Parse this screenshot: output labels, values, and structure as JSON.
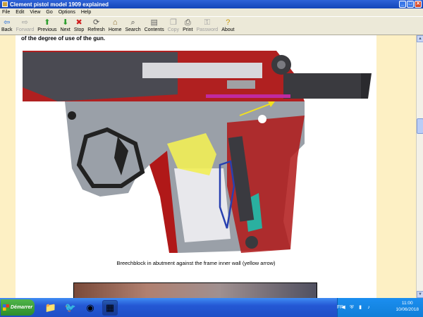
{
  "window": {
    "title": "Clement pistol model 1909 explained"
  },
  "menu": [
    "File",
    "Edit",
    "View",
    "Go",
    "Options",
    "Help"
  ],
  "toolbar": [
    {
      "label": "Back",
      "icon": "back-arrow-icon",
      "glyph": "⇦",
      "color": "#2a6fd8",
      "enabled": true
    },
    {
      "label": "Forward",
      "icon": "forward-arrow-icon",
      "glyph": "⇨",
      "color": "#a0a0a0",
      "enabled": false
    },
    {
      "label": "Previous",
      "icon": "up-arrow-icon",
      "glyph": "⬆",
      "color": "#2e9e2e",
      "enabled": true
    },
    {
      "label": "Next",
      "icon": "down-arrow-icon",
      "glyph": "⬇",
      "color": "#2e9e2e",
      "enabled": true
    },
    {
      "label": "Stop",
      "icon": "stop-icon",
      "glyph": "✖",
      "color": "#d02020",
      "enabled": true
    },
    {
      "label": "Refresh",
      "icon": "refresh-icon",
      "glyph": "⟳",
      "color": "#555555",
      "enabled": true
    },
    {
      "label": "Home",
      "icon": "home-icon",
      "glyph": "⌂",
      "color": "#8a6a2a",
      "enabled": true
    },
    {
      "label": "Search",
      "icon": "search-icon",
      "glyph": "⌕",
      "color": "#444444",
      "enabled": true
    },
    {
      "label": "Contents",
      "icon": "contents-icon",
      "glyph": "▤",
      "color": "#666666",
      "enabled": true
    },
    {
      "label": "Copy",
      "icon": "copy-icon",
      "glyph": "❐",
      "color": "#a0a0a0",
      "enabled": false
    },
    {
      "label": "Print",
      "icon": "print-icon",
      "glyph": "⎙",
      "color": "#444444",
      "enabled": true
    },
    {
      "label": "Password",
      "icon": "password-key-icon",
      "glyph": "⚿",
      "color": "#a0a0a0",
      "enabled": false
    },
    {
      "label": "About",
      "icon": "about-icon",
      "glyph": "?",
      "color": "#c89a10",
      "enabled": true
    }
  ],
  "page": {
    "top_text": "of the degree of use of the gun.",
    "caption": "Breechblock in abutment against the frame inner wall (yellow arrow)"
  },
  "taskbar": {
    "start_label": "Démarrer",
    "language": "FR",
    "time": "11:00",
    "date": "10/06/2018"
  }
}
